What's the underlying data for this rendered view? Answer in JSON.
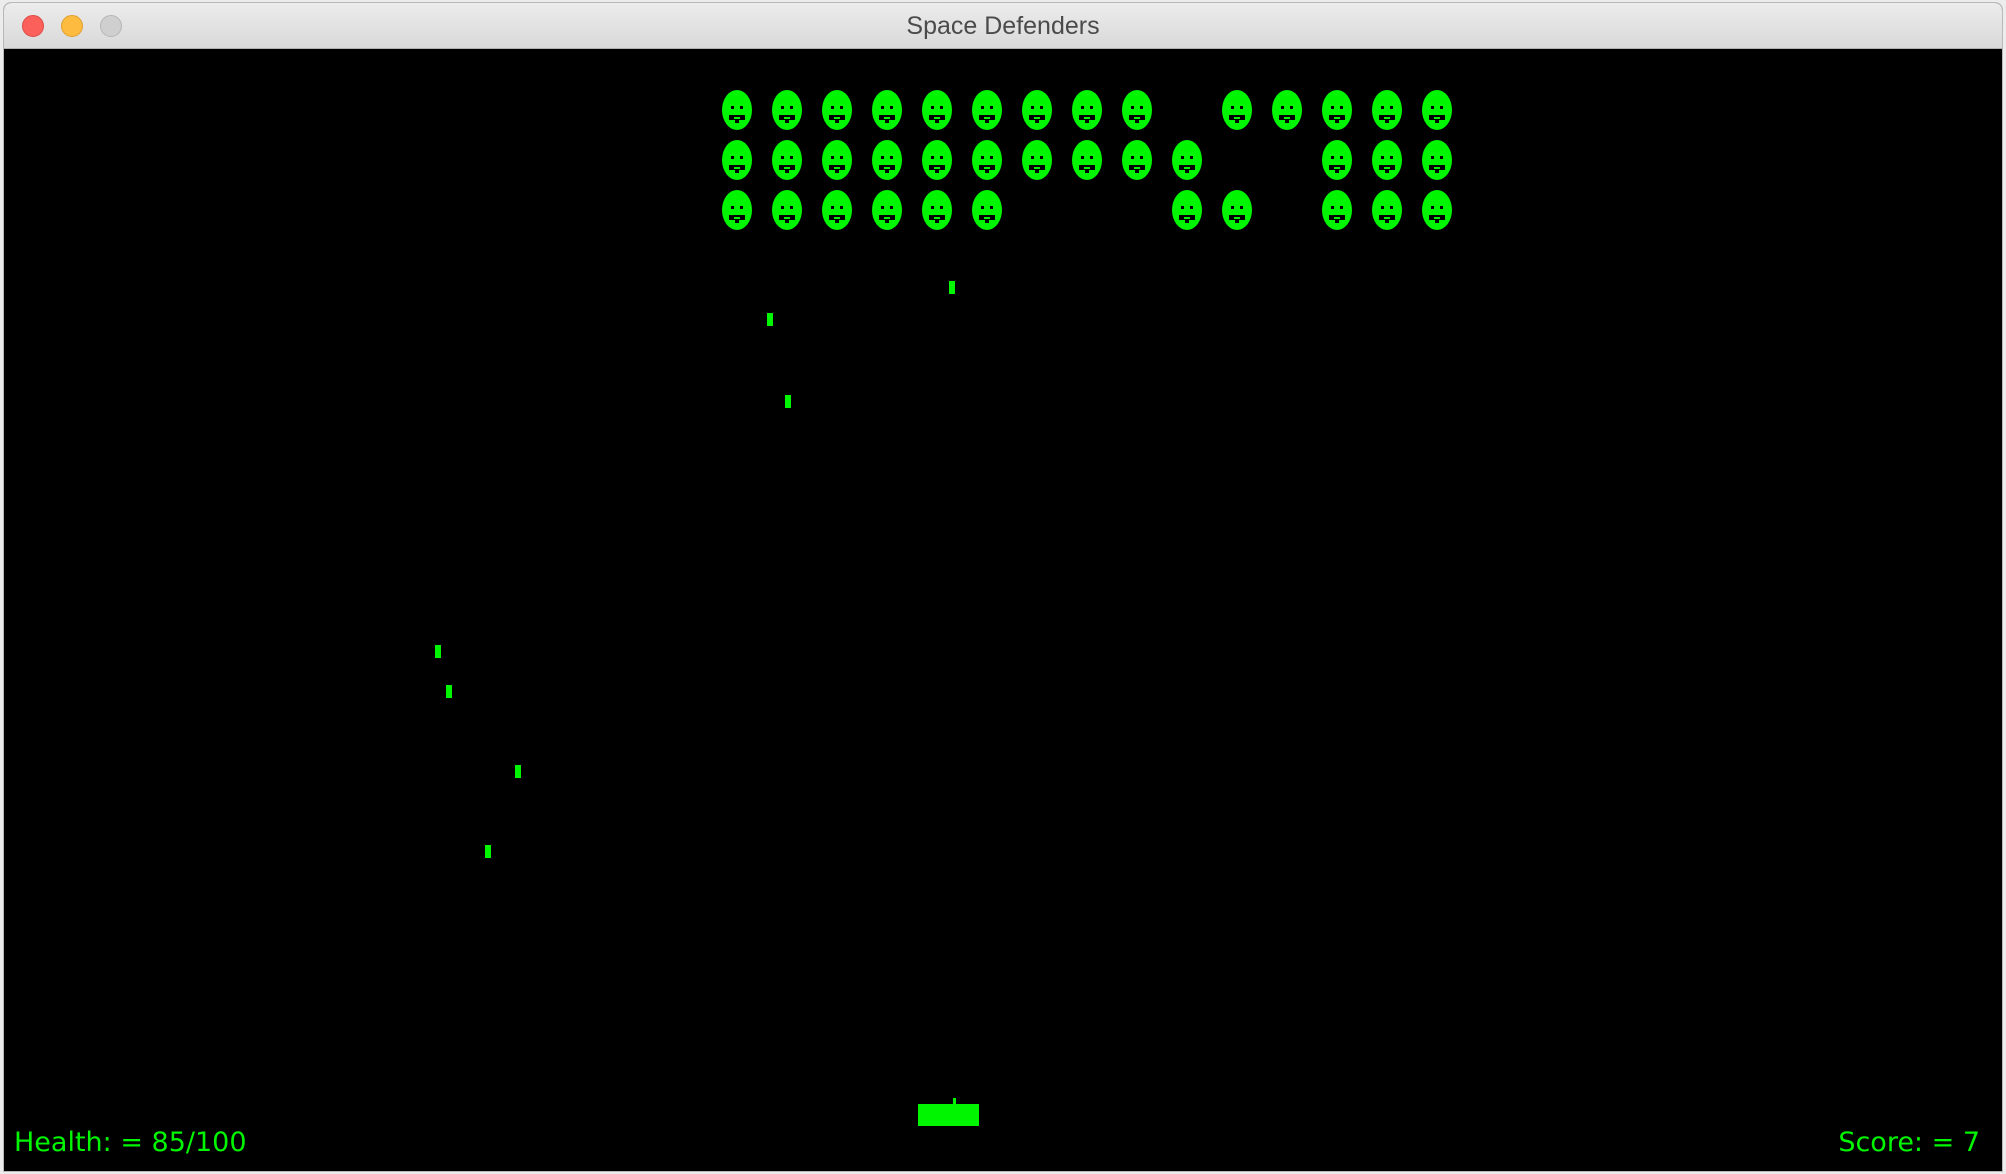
{
  "window": {
    "title": "Space Defenders"
  },
  "hud": {
    "health_text": "Health: = 85/100",
    "score_text": "Score: = 7",
    "health": 85,
    "health_max": 100,
    "score": 7
  },
  "colors": {
    "game_green": "#00f500",
    "background": "#000000"
  },
  "invaders": {
    "icon": "alien-face-icon",
    "rows": [
      [
        1,
        1,
        1,
        1,
        1,
        1,
        1,
        1,
        1,
        0,
        1,
        1,
        1,
        1,
        1
      ],
      [
        1,
        1,
        1,
        1,
        1,
        1,
        1,
        1,
        1,
        1,
        0,
        0,
        1,
        1,
        1
      ],
      [
        1,
        1,
        1,
        1,
        1,
        1,
        0,
        0,
        0,
        1,
        1,
        0,
        1,
        1,
        1
      ]
    ]
  },
  "player": {
    "icon": "player-cannon-icon"
  }
}
